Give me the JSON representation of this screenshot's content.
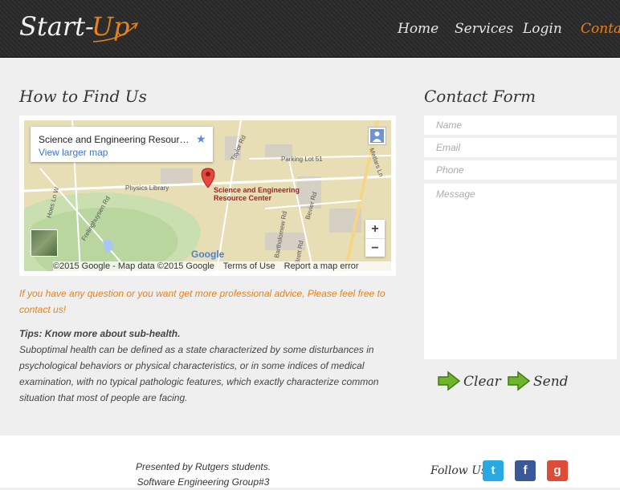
{
  "header": {
    "logo_part1": "Start-",
    "logo_part2": "Up",
    "nav": [
      {
        "label": "Home"
      },
      {
        "label": "Services"
      },
      {
        "label": "Login"
      },
      {
        "label": "Contacts",
        "active": true
      }
    ],
    "accent_color": "#e8821c"
  },
  "find_us": {
    "title": "How to Find Us",
    "map": {
      "place_title": "Science and Engineering Resourc...",
      "larger_map_link": "View larger map",
      "pin_label_line1": "Science and Engineering",
      "pin_label_line2": "Resource Center",
      "labels": [
        "Physics Library",
        "Parking Lot 51",
        "Taylor Rd",
        "Metlars Ln",
        "Hoes Ln W",
        "Frelinghuysen Rd",
        "Bevier Rd",
        "Bartholomew Rd",
        "Brett Rd"
      ],
      "zoom_in": "+",
      "zoom_out": "−",
      "google_logo": "Google",
      "attribution": "©2015 Google - Map data ©2015 Google",
      "terms": "Terms of Use",
      "report": "Report a map error"
    },
    "intro": "If you have any question or you want get more professional advice, Please feel free to contact us!",
    "tips_heading": "Tips: Know more about sub-health.",
    "tips_body": "Suboptimal health can be defined as a state characterized by some disturbances in psychological behaviors or physical characteristics, or in some indices of medical examination, with no typical pathologic features, which exactly characterize common situation that most of people are facing."
  },
  "contact_form": {
    "title": "Contact Form",
    "name_placeholder": "Name",
    "email_placeholder": "Email",
    "phone_placeholder": "Phone",
    "message_placeholder": "Message",
    "clear_label": "Clear",
    "send_label": "Send"
  },
  "footer": {
    "line1": "Presented by Rutgers students.",
    "line2": "Software Engineering Group#3",
    "follow_label": "Follow Us:",
    "social": [
      {
        "name": "twitter-icon",
        "glyph": "t",
        "color": "#29a9e1"
      },
      {
        "name": "facebook-icon",
        "glyph": "f",
        "color": "#3b5998"
      },
      {
        "name": "google-plus-icon",
        "glyph": "g",
        "color": "#dd4b39"
      }
    ]
  }
}
